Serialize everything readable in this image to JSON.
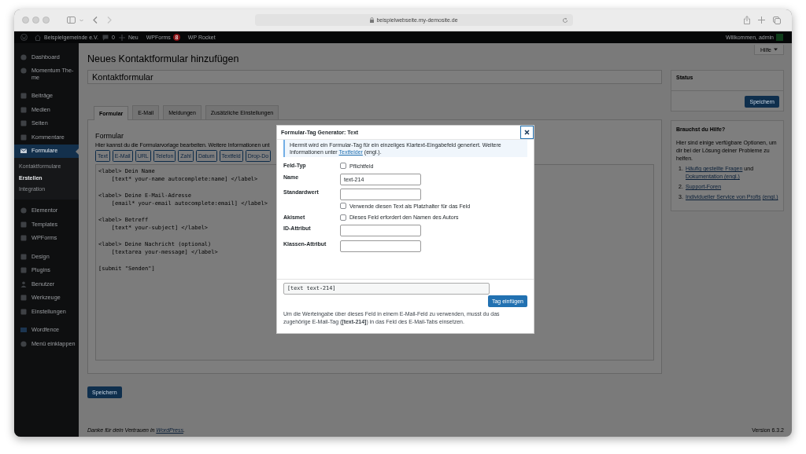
{
  "browser": {
    "url": "beispielwebseite.my-demosite.de"
  },
  "admin_bar": {
    "site": "Beispielgemeinde e.V.",
    "comments": "0",
    "new": "Neu",
    "items": [
      {
        "label": "WPForms",
        "badge": "8"
      },
      {
        "label": "WP Rocket"
      }
    ],
    "greeting": "Willkommen, admin"
  },
  "sidebar": {
    "groups": [
      [
        {
          "label": "Dashboard",
          "selected": false
        },
        {
          "label": "Momentum The-\nme",
          "selected": false
        }
      ],
      [
        {
          "label": "Beiträge",
          "selected": false
        },
        {
          "label": "Medien",
          "selected": false
        },
        {
          "label": "Seiten",
          "selected": false
        },
        {
          "label": "Kommentare",
          "selected": false
        },
        {
          "label": "Formulare",
          "selected": true,
          "children": [
            {
              "label": "Kontaktformulare",
              "selected": false
            },
            {
              "label": "Erstellen",
              "selected": true
            },
            {
              "label": "Integration",
              "selected": false
            }
          ]
        }
      ],
      [
        {
          "label": "Elementor",
          "selected": false
        },
        {
          "label": "Templates",
          "selected": false
        },
        {
          "label": "WPForms",
          "selected": false
        }
      ],
      [
        {
          "label": "Design",
          "selected": false
        },
        {
          "label": "Plugins",
          "selected": false
        },
        {
          "label": "Benutzer",
          "selected": false
        },
        {
          "label": "Werkzeuge",
          "selected": false
        },
        {
          "label": "Einstellungen",
          "selected": false
        }
      ],
      [
        {
          "label": "Wordfence",
          "selected": false
        },
        {
          "label": "Menü einklappen",
          "selected": false
        }
      ]
    ]
  },
  "help_tab": "Hilfe",
  "heading": "Neues Kontaktformular hinzufügen",
  "title_field": {
    "value": "Kontaktformular"
  },
  "tabs": [
    {
      "label": "Formular",
      "selected": true
    },
    {
      "label": "E-Mail",
      "selected": false
    },
    {
      "label": "Meldungen",
      "selected": false
    },
    {
      "label": "Zusätzliche Einstellungen",
      "selected": false
    }
  ],
  "form_panel": {
    "title": "Formular",
    "description": "Hier kannst du die Formularvorlage bearbeiten. Weitere Informationen unt",
    "tag_buttons": [
      "Text",
      "E-Mail",
      "URL",
      "Telefon",
      "Zahl",
      "Datum",
      "Textfeld",
      "Drop-Do"
    ],
    "code": [
      [
        "<label> Dein Name",
        "    [text* your-name autocomplete:name] </label>"
      ],
      [
        "<label> Deine E-Mail-Adresse",
        "    [email* your-email autocomplete:email] </label>"
      ],
      [
        "<label> Betreff",
        "    [text* your-subject] </label>"
      ],
      [
        "<label> Deine Nachricht (optional)",
        "    [textarea your-message] </label>"
      ],
      [
        "[submit \"Senden\"]"
      ]
    ]
  },
  "save_button": "Speichern",
  "footer": {
    "thanks_before": "Danke für dein Vertrauen in ",
    "thanks_link": "WordPress",
    "thanks_after": ".",
    "version": "Version 6.3.2"
  },
  "status_box": {
    "title": "Status",
    "button": "Speichern"
  },
  "help_box": {
    "title": "Brauchst du Hilfe?",
    "text": "Hier sind einige verfügbare Optionen, um dir bei der Lösung deiner Probleme zu helfen.",
    "items": [
      {
        "number": "1.",
        "parts": [
          {
            "kind": "link",
            "text": "Häufig gestellte Fragen"
          },
          {
            "kind": "text",
            "text": "und"
          },
          {
            "kind": "link",
            "text": "Dokumentation (engl.)"
          }
        ]
      },
      {
        "number": "2.",
        "parts": [
          {
            "kind": "link",
            "text": "Support-Foren"
          }
        ]
      },
      {
        "number": "3.",
        "parts": [
          {
            "kind": "link",
            "text": "Individueller Service von Profis"
          },
          {
            "kind": "link",
            "text": "(engl.)"
          }
        ]
      }
    ]
  },
  "dialog": {
    "title": "Formular-Tag Generator: Text",
    "notice_before": "Hiermit wird ein Formular-Tag für ein einzeliges Klartext-Eingabefeld generiert. Weitere Informationen unter ",
    "notice_link": "Textfelder",
    "notice_after": " (engl.).",
    "rows": [
      {
        "label": "Feld-Typ",
        "kind": "checkbox",
        "option": "Pflichtfeld",
        "checked": false
      },
      {
        "label": "Name",
        "kind": "text",
        "value": "text-214"
      },
      {
        "label": "Standardwert",
        "kind": "text_checkbox",
        "option": "Verwende diesen Text als Platzhalter für das Feld",
        "checked": false
      },
      {
        "label": "Akismet",
        "kind": "checkbox",
        "option": "Dieses Feld erfordert den Namen des Autors",
        "checked": false
      },
      {
        "label": "ID-Attribut",
        "kind": "text"
      },
      {
        "label": "Klassen-Attribut",
        "kind": "text"
      }
    ],
    "tag_value": "[text text-214]",
    "insert_button": "Tag einfügen",
    "note": "Um die Werteingabe über dieses Feld in einem E-Mail-Feld zu verwenden, musst du das zugehörige E-Mail-Tag (**[text-214]**) in das Feld des E-Mail-Tabs einsetzen."
  }
}
